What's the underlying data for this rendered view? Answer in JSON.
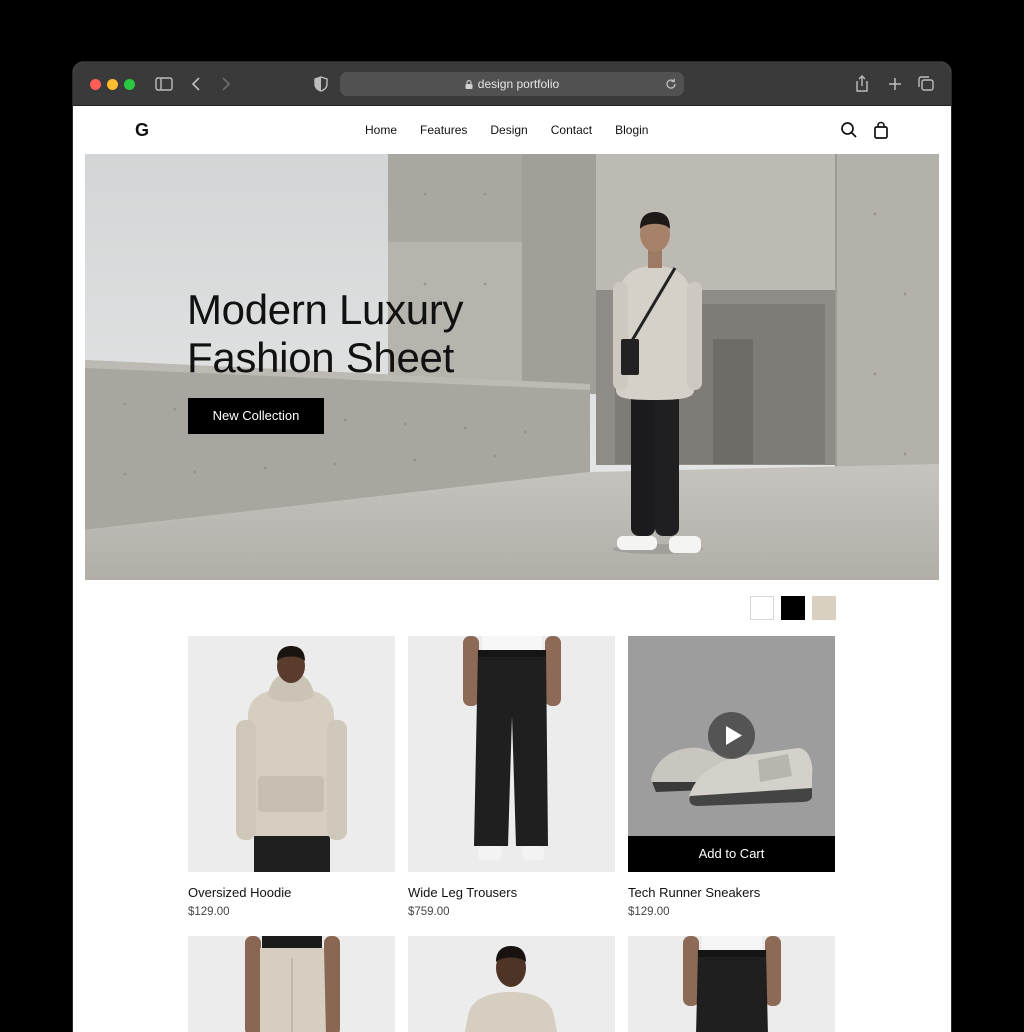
{
  "browser": {
    "url": "design portfolio",
    "icons": [
      "sidebar-icon",
      "back-icon",
      "forward-icon",
      "shield-icon",
      "lock-icon",
      "reload-icon",
      "share-icon",
      "new-tab-icon",
      "tabs-icon"
    ]
  },
  "site": {
    "logo": "G",
    "nav": [
      "Home",
      "Features",
      "Design",
      "Contact",
      "Blogin"
    ],
    "icons": [
      "search-icon",
      "bag-icon"
    ]
  },
  "hero": {
    "title_line1": "Modern Luxury",
    "title_line2": "Fashion Sheet",
    "cta": "New Collection"
  },
  "swatches": [
    "#ffffff",
    "#000000",
    "#d9d0c1"
  ],
  "products": [
    {
      "name": "Oversized Hoodie",
      "price": "$129.00"
    },
    {
      "name": "Wide Leg Trousers",
      "price": "$759.00"
    },
    {
      "name": "Tech Runner Sneakers",
      "price": "$129.00",
      "action": "Add to Cart"
    }
  ],
  "colors": {
    "accent": "#000000",
    "background": "#ffffff",
    "hoodie": "#d6cfc1",
    "concrete": "#b9b6b0"
  }
}
